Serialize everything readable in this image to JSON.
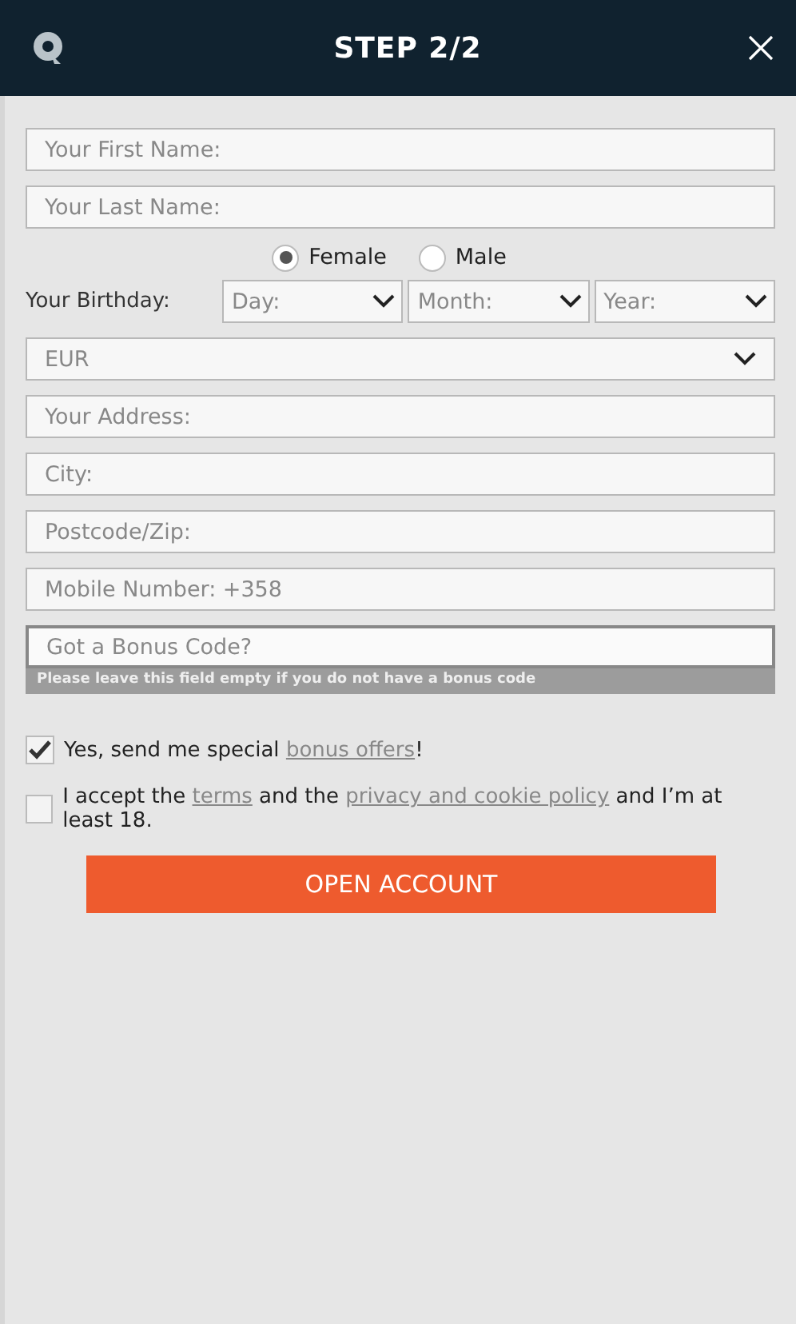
{
  "header": {
    "title": "STEP 2/2"
  },
  "name_fields": [
    {
      "placeholder": "Your First Name:"
    },
    {
      "placeholder": "Your Last Name:"
    }
  ],
  "gender": [
    {
      "label": "Female",
      "selected": true
    },
    {
      "label": "Male",
      "selected": false
    }
  ],
  "birthday": {
    "label": "Your Birthday:",
    "selects": [
      {
        "placeholder": "Day:"
      },
      {
        "placeholder": "Month:"
      },
      {
        "placeholder": "Year:"
      }
    ]
  },
  "currency": {
    "value": "EUR"
  },
  "address_fields": [
    {
      "placeholder": "Your Address:"
    },
    {
      "placeholder": "City:"
    },
    {
      "placeholder": "Postcode/Zip:"
    },
    {
      "placeholder": "Mobile Number: +358"
    }
  ],
  "bonus_code": {
    "placeholder": "Got a Bonus Code?",
    "focused": true,
    "hint": "Please leave this field empty if you do not have a bonus code"
  },
  "consents": [
    {
      "text": "Yes, send me special ",
      "link": "bonus offers",
      "text_2": "!",
      "checked": true
    },
    {
      "text": "I accept the ",
      "link": "terms",
      "text_2": " and the ",
      "link_2": "privacy and cookie policy",
      "text_3": " and I’m at least 18.",
      "checked": false
    }
  ],
  "submit": {
    "label": "OPEN ACCOUNT"
  }
}
